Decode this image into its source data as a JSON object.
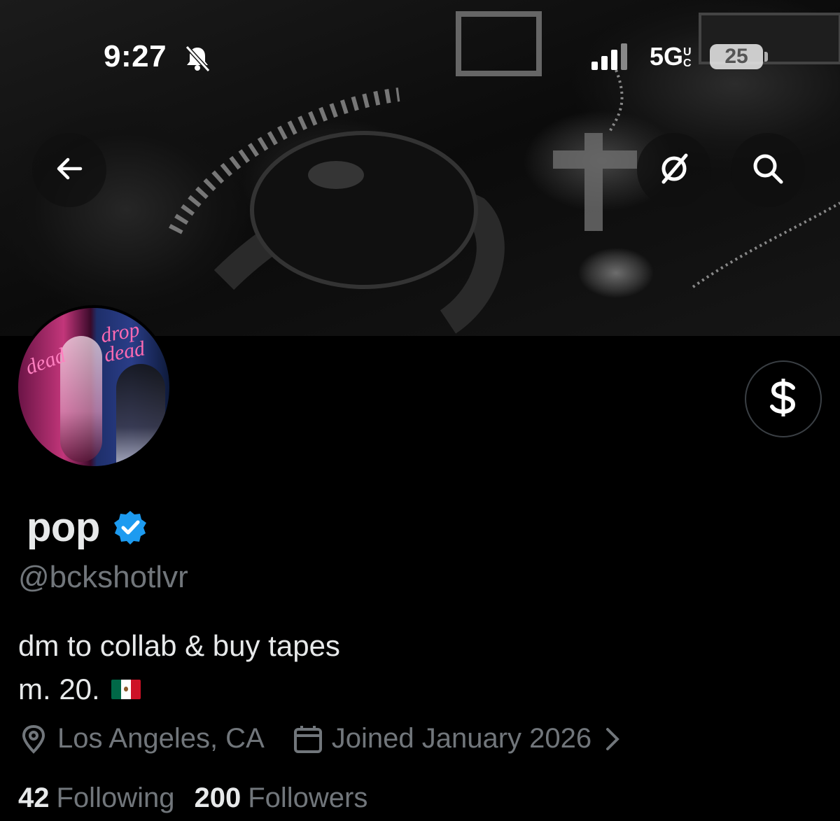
{
  "status_bar": {
    "time": "9:27",
    "network": "5G",
    "network_suffix": "UC",
    "battery": "25"
  },
  "icons": {
    "back": "arrow-left-icon",
    "grok": "grok-icon",
    "search": "search-icon",
    "tip": "dollar-sign-icon",
    "verified": "verified-badge-icon",
    "location": "location-pin-icon",
    "calendar": "calendar-icon",
    "chevron": "chevron-right-icon",
    "bell": "bell-slash-icon",
    "signal": "cellular-signal-icon"
  },
  "colors": {
    "background": "#000000",
    "text_primary": "#e7e9ea",
    "text_secondary": "#71767b",
    "verified_blue": "#1d9bf0"
  },
  "profile": {
    "display_name": "pop",
    "handle": "@bckshotlvr",
    "bio_line1": "dm to collab & buy tapes",
    "bio_line2": "m. 20.",
    "location": "Los Angeles, CA",
    "joined": "Joined January 2026",
    "following_count": "42",
    "following_label": "Following",
    "followers_count": "200",
    "followers_label": "Followers",
    "avatar_text_left": "dead",
    "avatar_text_right": "drop dead"
  }
}
